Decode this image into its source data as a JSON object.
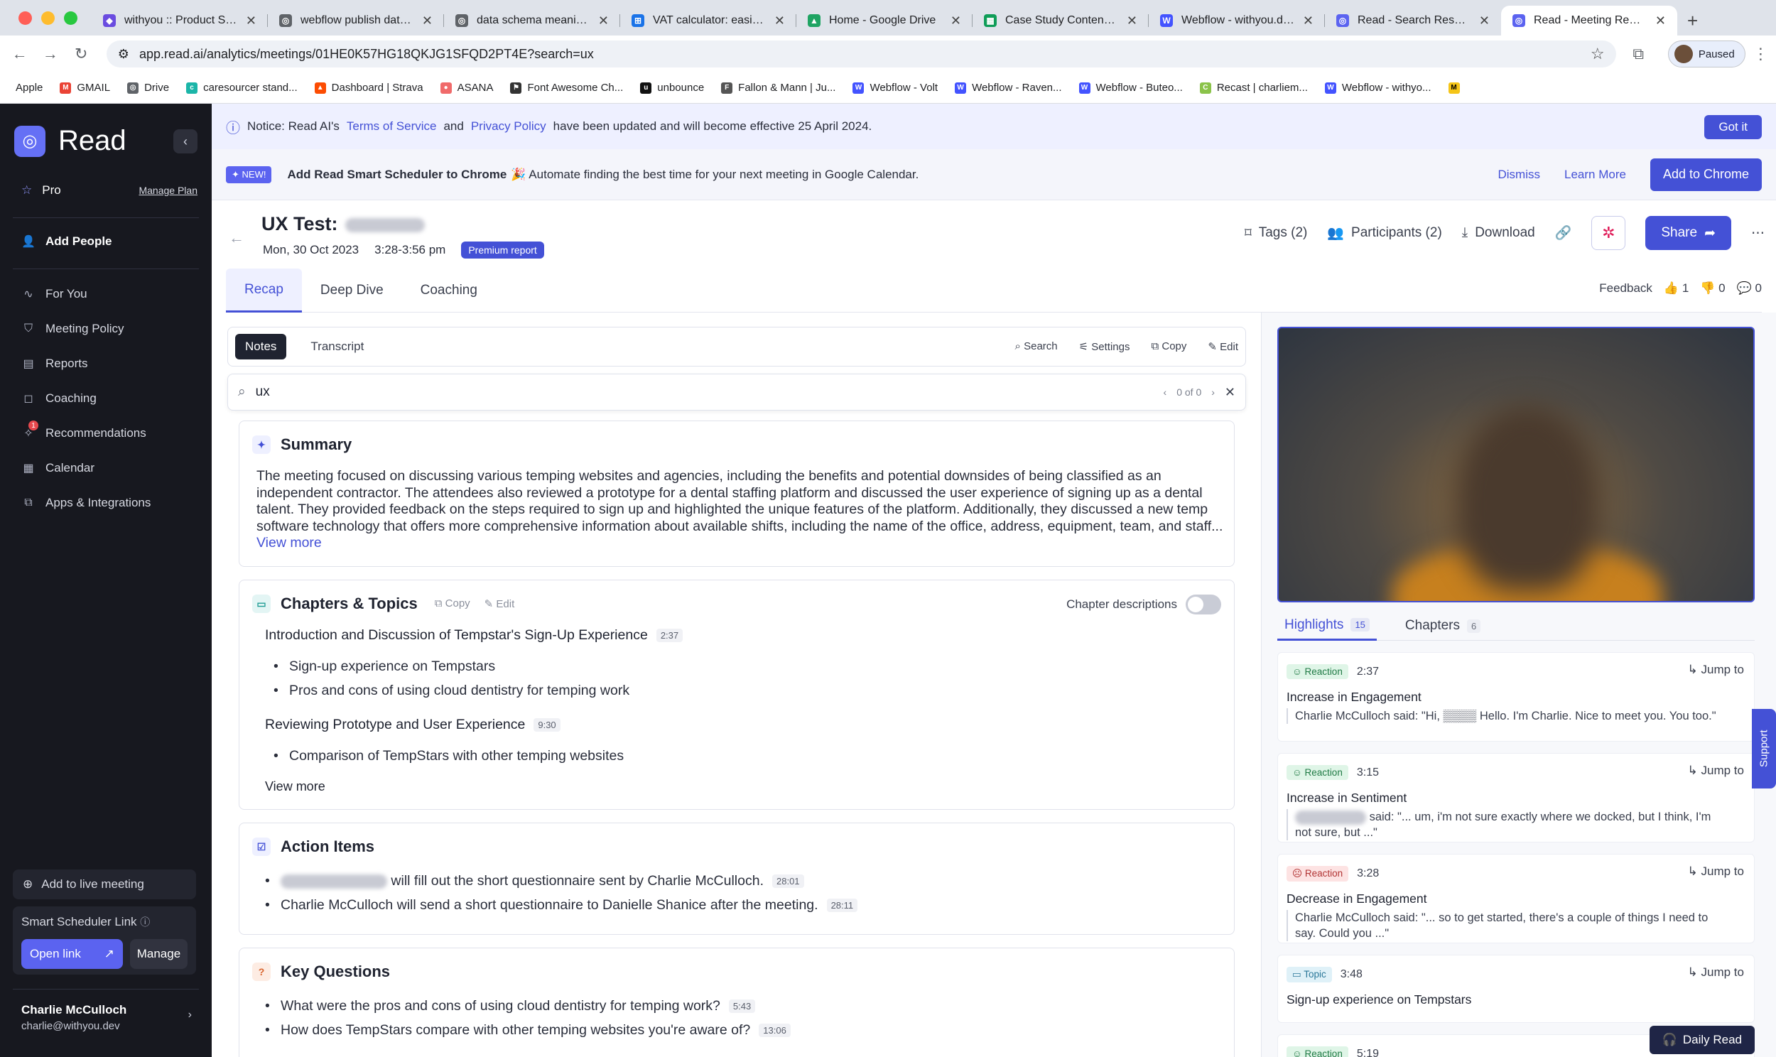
{
  "browser": {
    "tabs": [
      {
        "title": "withyou :: Product Stra",
        "icon_color": "#6a4ce0"
      },
      {
        "title": "webflow publish date b",
        "icon_color": "#5f6368"
      },
      {
        "title": "data schema meaning -",
        "icon_color": "#5f6368"
      },
      {
        "title": "VAT calculator: easily a",
        "icon_color": "#1a73e8"
      },
      {
        "title": "Home - Google Drive",
        "icon_color": "#1fa463"
      },
      {
        "title": "Case Study Content - C",
        "icon_color": "#0f9d58"
      },
      {
        "title": "Webflow - withyou.dev",
        "icon_color": "#4353ff"
      },
      {
        "title": "Read - Search Results",
        "icon_color": "#5b63f0"
      },
      {
        "title": "Read - Meeting Report",
        "icon_color": "#5b63f0"
      }
    ],
    "url": "app.read.ai/analytics/meetings/01HE0K57HG18QKJG1SFQD2PT4E?search=ux",
    "profile_label": "Paused",
    "bookmarks": [
      "Apple",
      "GMAIL",
      "Drive",
      "caresourcer stand...",
      "Dashboard | Strava",
      "ASANA",
      "Font Awesome Ch...",
      "unbounce",
      "Fallon & Mann | Ju...",
      "Webflow - Volt",
      "Webflow - Raven...",
      "Webflow - Buteo...",
      "Recast | charliem...",
      "Webflow - withyo..."
    ]
  },
  "sidebar": {
    "brand": "Read",
    "plan": "Pro",
    "manage_plan": "Manage Plan",
    "add_people": "Add People",
    "items": [
      "For You",
      "Meeting Policy",
      "Reports",
      "Coaching",
      "Recommendations",
      "Calendar",
      "Apps & Integrations"
    ],
    "recommendations_badge": "1",
    "add_live": "Add to live meeting",
    "scheduler_title": "Smart Scheduler Link",
    "open_link": "Open link",
    "manage": "Manage",
    "user_name": "Charlie McCulloch",
    "user_email": "charlie@withyou.dev"
  },
  "notice": {
    "prefix": "Notice: Read AI's",
    "tos": "Terms of Service",
    "and": "and",
    "privacy": "Privacy Policy",
    "suffix": "have been updated and will become effective 25 April 2024.",
    "button": "Got it"
  },
  "promo": {
    "badge": "✦ NEW!",
    "title": "Add Read Smart Scheduler to Chrome",
    "text": "🎉 Automate finding the best time for your next meeting in Google Calendar.",
    "dismiss": "Dismiss",
    "learn_more": "Learn More",
    "cta": "Add to Chrome"
  },
  "meeting": {
    "title": "UX Test:",
    "date": "Mon, 30 Oct 2023",
    "time": "3:28-3:56 pm",
    "badge": "Premium report",
    "tags": "Tags (2)",
    "participants": "Participants (2)",
    "download": "Download",
    "share": "Share"
  },
  "tabs": [
    "Recap",
    "Deep Dive",
    "Coaching"
  ],
  "feedback": {
    "label": "Feedback",
    "up": "1",
    "down": "0",
    "comments": "0"
  },
  "notes": {
    "pills": [
      "Notes",
      "Transcript"
    ],
    "tools": [
      "Search",
      "Settings",
      "Copy",
      "Edit"
    ],
    "search_value": "ux",
    "search_count": "0 of 0"
  },
  "summary": {
    "title": "Summary",
    "text": "The meeting focused on discussing various temping websites and agencies, including the benefits and potential downsides of being classified as an independent contractor. The attendees also reviewed a prototype for a dental staffing platform and discussed the user experience of signing up as a dental talent. They provided feedback on the steps required to sign up and highlighted the unique features of the platform. Additionally, they discussed a new temp software technology that offers more comprehensive information about available shifts, including the name of the office, address, equipment, team, and staff...",
    "more": "View more"
  },
  "chapters": {
    "title": "Chapters & Topics",
    "copy": "Copy",
    "edit": "Edit",
    "toggle_label": "Chapter descriptions",
    "list": [
      {
        "title": "Introduction and Discussion of Tempstar's Sign-Up Experience",
        "time": "2:37",
        "bullets": [
          "Sign-up experience on Tempstars",
          "Pros and cons of using cloud dentistry for temping work"
        ]
      },
      {
        "title": "Reviewing Prototype and User Experience",
        "time": "9:30",
        "bullets": [
          "Comparison of TempStars with other temping websites"
        ]
      }
    ],
    "more": "View more"
  },
  "actions": {
    "title": "Action Items",
    "items": [
      {
        "text": "will fill out the short questionnaire sent by Charlie McCulloch.",
        "time": "28:01"
      },
      {
        "text": "Charlie McCulloch will send a short questionnaire to Danielle Shanice after the meeting.",
        "time": "28:11"
      }
    ]
  },
  "questions": {
    "title": "Key Questions",
    "items": [
      {
        "text": "What were the pros and cons of using cloud dentistry for temping work?",
        "time": "5:43"
      },
      {
        "text": "How does TempStars compare with other temping websites you're aware of?",
        "time": "13:06"
      }
    ]
  },
  "highlights": {
    "tabs": [
      {
        "label": "Highlights",
        "count": "15"
      },
      {
        "label": "Chapters",
        "count": "6"
      }
    ],
    "jump": "Jump to",
    "items": [
      {
        "tag": "Reaction",
        "time": "2:37",
        "title": "Increase in Engagement",
        "quote": "Charlie McCulloch said: \"Hi, ▒▒▒▒ Hello. I'm Charlie. Nice to meet you. You too.\""
      },
      {
        "tag": "Reaction",
        "time": "3:15",
        "title": "Increase in Sentiment",
        "quote": "said: \"... um, i'm not sure exactly where we docked, but I think, I'm not sure, but ...\""
      },
      {
        "tag": "Reaction",
        "time": "3:28",
        "title": "Decrease in Engagement",
        "quote": "Charlie McCulloch said: \"... so to get started, there's a couple of things I need to say. Could you ...\""
      },
      {
        "tag": "Topic",
        "time": "3:48",
        "title": "Sign-up experience on Tempstars",
        "quote": ""
      },
      {
        "tag": "Reaction",
        "time": "5:19",
        "title": "",
        "quote": ""
      }
    ]
  },
  "support": "Support",
  "daily_read": "Daily Read"
}
